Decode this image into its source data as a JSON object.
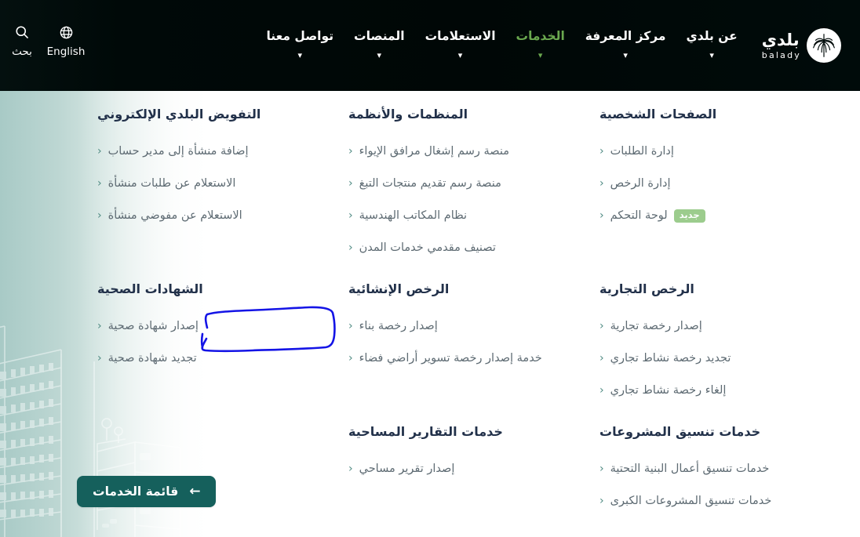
{
  "header": {
    "brand": {
      "name_ar": "بلدي",
      "name_en": "balady",
      "logo_icon": "palm-tree-logo-icon"
    },
    "nav_items": [
      {
        "label": "عن بلدي",
        "has_dropdown": true,
        "active": false
      },
      {
        "label": "مركز المعرفة",
        "has_dropdown": true,
        "active": false
      },
      {
        "label": "الخدمات",
        "has_dropdown": true,
        "active": true
      },
      {
        "label": "الاستعلامات",
        "has_dropdown": true,
        "active": false
      },
      {
        "label": "المنصات",
        "has_dropdown": true,
        "active": false
      },
      {
        "label": "تواصل معنا",
        "has_dropdown": true,
        "active": false
      }
    ],
    "utils": [
      {
        "label": "بحث",
        "icon": "search-icon"
      },
      {
        "label": "English",
        "icon": "globe-icon"
      }
    ],
    "colors": {
      "background": "#000b0a",
      "active_nav": "#6aa84f",
      "text": "#ffffff"
    }
  },
  "mega_menu": {
    "columns": [
      {
        "id": "column-right",
        "groups": [
          {
            "title": "الصفحات الشخصية",
            "links": [
              {
                "label": "إدارة الطلبات",
                "badge": null
              },
              {
                "label": "إدارة الرخص",
                "badge": null
              },
              {
                "label": "لوحة التحكم",
                "badge": "جديد"
              }
            ]
          },
          {
            "title": "الرخص التجارية",
            "links": [
              {
                "label": "إصدار رخصة تجارية",
                "badge": null
              },
              {
                "label": "تجديد رخصة نشاط تجاري",
                "badge": null
              },
              {
                "label": "إلغاء رخصة نشاط تجاري",
                "badge": null
              }
            ]
          },
          {
            "title": "خدمات تنسيق المشروعات",
            "links": [
              {
                "label": "خدمات تنسيق أعمال البنية التحتية",
                "badge": null
              },
              {
                "label": "خدمات تنسيق المشروعات الكبرى",
                "badge": null
              }
            ]
          }
        ]
      },
      {
        "id": "column-middle",
        "groups": [
          {
            "title": "المنظمات والأنظمة",
            "links": [
              {
                "label": "منصة رسم إشغال مرافق الإيواء",
                "badge": null
              },
              {
                "label": "منصة رسم تقديم منتجات التبغ",
                "badge": null
              },
              {
                "label": "نظام المكاتب الهندسية",
                "badge": null
              },
              {
                "label": "تصنيف مقدمي خدمات المدن",
                "badge": null
              }
            ]
          },
          {
            "title": "الرخص الإنشائية",
            "links": [
              {
                "label": "إصدار رخصة بناء",
                "badge": null
              },
              {
                "label": "خدمة إصدار رخصة تسوير أراضي فضاء",
                "badge": null
              }
            ]
          },
          {
            "title": "خدمات التقارير المساحية",
            "links": [
              {
                "label": "إصدار تقرير مساحي",
                "badge": null
              }
            ]
          }
        ]
      },
      {
        "id": "column-left",
        "groups": [
          {
            "title": "التفويض البلدي الإلكتروني",
            "links": [
              {
                "label": "إضافة منشأة إلى مدير حساب",
                "badge": null
              },
              {
                "label": "الاستعلام عن طلبات منشأة",
                "badge": null
              },
              {
                "label": "الاستعلام عن مفوضي منشأة",
                "badge": null
              }
            ]
          },
          {
            "title": "الشهادات الصحية",
            "links": [
              {
                "label": "إصدار شهادة صحية",
                "badge": null,
                "annotated": true
              },
              {
                "label": "تجديد شهادة صحية",
                "badge": null
              }
            ]
          }
        ]
      }
    ],
    "services_list_button": {
      "label": "قائمة الخدمات",
      "icon": "arrow-left-icon",
      "color": "#15605c"
    },
    "colors": {
      "group_title": "#22314a",
      "link_text": "#5e6b73",
      "chevron": "#4e8a82",
      "badge_bg": "#9ccc8d",
      "annotation": "#1414e6"
    }
  },
  "annotation": {
    "type": "hand-drawn-rectangle",
    "color": "#1414e6",
    "target": "إصدار شهادة صحية"
  }
}
